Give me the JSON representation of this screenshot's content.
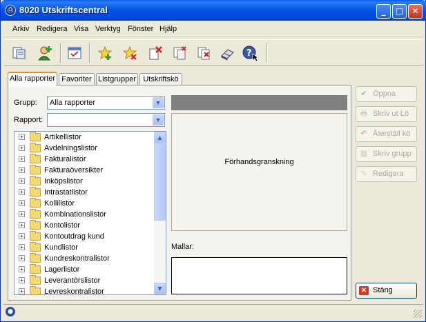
{
  "window": {
    "title": "8020 Utskriftscentral"
  },
  "menu": [
    "Arkiv",
    "Redigera",
    "Visa",
    "Verktyg",
    "Fönster",
    "Hjälp"
  ],
  "toolbar_icons": [
    "report-icon",
    "add-user-icon",
    "scheduler-icon",
    "add-favorite-icon",
    "remove-favorite-icon",
    "delete-icon",
    "copy-icon",
    "delete-copy-icon",
    "book-icon",
    "help-pointer-icon"
  ],
  "tabs": [
    "Alla rapporter",
    "Favoriter",
    "Listgrupper",
    "Utskriftskö"
  ],
  "form": {
    "grupp_label": "Grupp:",
    "grupp_value": "Alla rapporter",
    "rapport_label": "Rapport:",
    "rapport_value": ""
  },
  "tree": [
    "Artikellistor",
    "Avdelningslistor",
    "Fakturalistor",
    "Fakturaöversikter",
    "Inköpslistor",
    "Intrastatlistor",
    "Kollilistor",
    "Kombinationslistor",
    "Kontolistor",
    "Kontoutdrag kund",
    "Kundlistor",
    "Kundreskontralistor",
    "Lagerlistor",
    "Leverantörslistor",
    "Levreskontralistor"
  ],
  "preview": {
    "text": "Förhandsgranskning"
  },
  "mallar": {
    "label": "Mallar:"
  },
  "buttons": {
    "oppna": "Öppna",
    "skriv_ut": "Skriv ut Lö",
    "aterstall": "Återställ kö",
    "skriv_grupp": "Skriv grupp",
    "redigera": "Redigera",
    "stang": "Stäng"
  }
}
